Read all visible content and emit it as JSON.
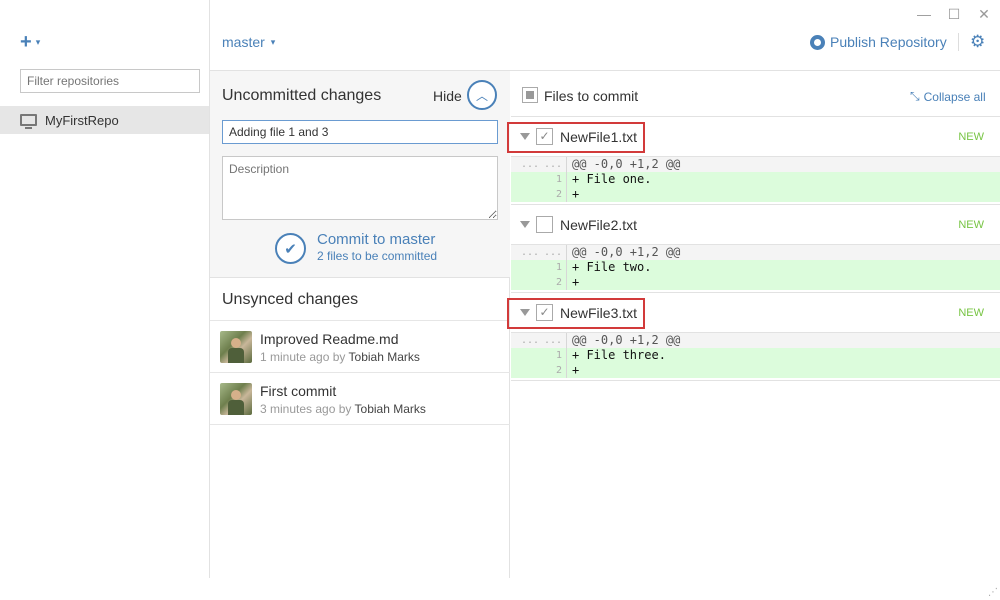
{
  "window": {
    "minimize_glyph": "—",
    "maximize_glyph": "☐",
    "close_glyph": "✕"
  },
  "sidebar": {
    "add_glyph": "+",
    "add_caret": "▾",
    "filter_placeholder": "Filter repositories",
    "repos": [
      {
        "name": "MyFirstRepo",
        "icon": "monitor-icon"
      }
    ]
  },
  "header": {
    "branch": "master",
    "branch_caret": "▾",
    "publish_label": "Publish Repository",
    "publish_icon": "github-icon",
    "settings_icon": "gear-icon",
    "settings_glyph": "⚙"
  },
  "uncommitted": {
    "title": "Uncommitted changes",
    "hide_label": "Hide",
    "hide_glyph": "︿",
    "summary_value": "Adding file 1 and 3",
    "description_placeholder": "Description",
    "commit_glyph": "✔",
    "commit_label": "Commit to master",
    "commit_sub": "2 files to be committed"
  },
  "unsynced": {
    "title": "Unsynced changes",
    "commits": [
      {
        "title": "Improved Readme.md",
        "time": "1 minute ago by",
        "author": "Tobiah Marks"
      },
      {
        "title": "First commit",
        "time": "3 minutes ago by",
        "author": "Tobiah Marks"
      }
    ]
  },
  "files": {
    "header_label": "Files to commit",
    "collapse_label": "Collapse all",
    "collapse_glyph": "⤡",
    "items": [
      {
        "name": "NewFile1.txt",
        "checked": true,
        "badge": "NEW",
        "hunk": "@@ -0,0 +1,2 @@",
        "lines": [
          {
            "n": "1",
            "text": "+ File one."
          },
          {
            "n": "2",
            "text": "+"
          }
        ]
      },
      {
        "name": "NewFile2.txt",
        "checked": false,
        "badge": "NEW",
        "hunk": "@@ -0,0 +1,2 @@",
        "lines": [
          {
            "n": "1",
            "text": "+ File two."
          },
          {
            "n": "2",
            "text": "+"
          }
        ]
      },
      {
        "name": "NewFile3.txt",
        "checked": true,
        "badge": "NEW",
        "hunk": "@@ -0,0 +1,2 @@",
        "lines": [
          {
            "n": "1",
            "text": "+ File three."
          },
          {
            "n": "2",
            "text": "+"
          }
        ]
      }
    ],
    "hunk_dots": "..."
  },
  "colors": {
    "accent": "#4a81b8",
    "new_badge": "#77c443",
    "added_line_bg": "#dcfcdc",
    "highlight_box": "#d23a3a"
  }
}
